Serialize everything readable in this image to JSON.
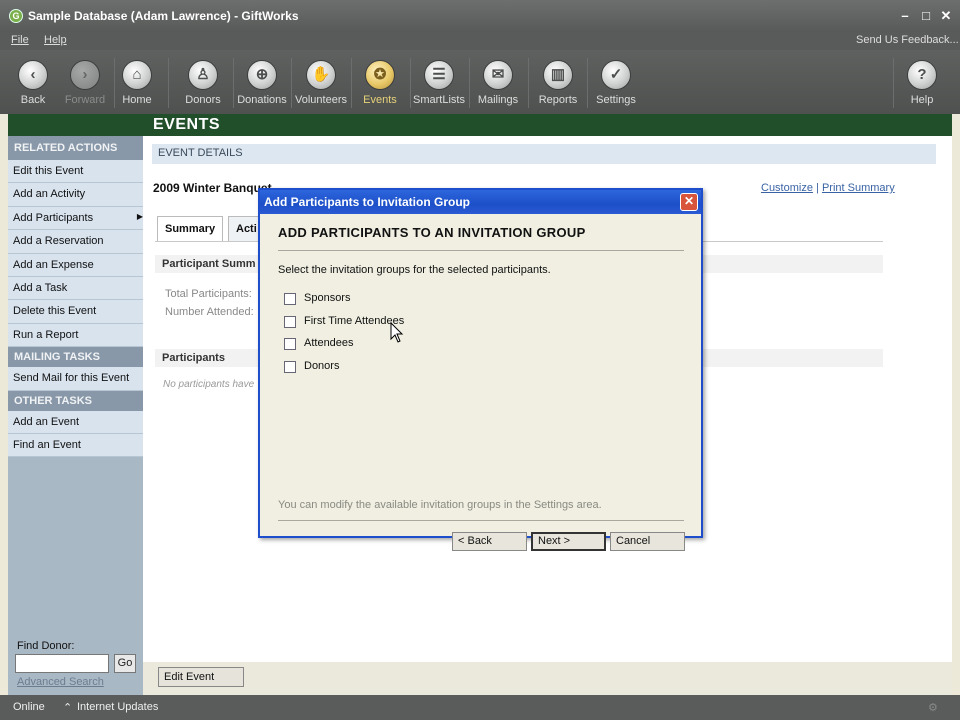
{
  "window": {
    "title": "Sample Database (Adam Lawrence) - GiftWorks",
    "controls": [
      "minimize",
      "maximize",
      "close"
    ]
  },
  "menu": {
    "file": "File",
    "help": "Help",
    "feedback": "Send Us Feedback..."
  },
  "toolbar": {
    "items": [
      {
        "label": "Back",
        "icon": "back-arrow-icon",
        "glyph": "‹"
      },
      {
        "label": "Forward",
        "icon": "forward-arrow-icon",
        "glyph": "›"
      },
      {
        "label": "Home",
        "icon": "home-icon",
        "glyph": "⌂"
      },
      {
        "label": "Donors",
        "icon": "donors-icon",
        "glyph": "♙"
      },
      {
        "label": "Donations",
        "icon": "donations-icon",
        "glyph": "⊕"
      },
      {
        "label": "Volunteers",
        "icon": "volunteers-hand-icon",
        "glyph": "✋"
      },
      {
        "label": "Events",
        "icon": "events-icon",
        "glyph": "✪"
      },
      {
        "label": "SmartLists",
        "icon": "smartlists-icon",
        "glyph": "☰"
      },
      {
        "label": "Mailings",
        "icon": "mailings-envelope-icon",
        "glyph": "✉"
      },
      {
        "label": "Reports",
        "icon": "reports-chart-icon",
        "glyph": "▥"
      },
      {
        "label": "Settings",
        "icon": "settings-check-icon",
        "glyph": "✓"
      },
      {
        "label": "Help",
        "icon": "help-question-icon",
        "glyph": "?"
      }
    ]
  },
  "section_header": "EVENTS",
  "sidebar": {
    "related_actions_header": "RELATED ACTIONS",
    "related_actions": [
      "Edit this Event",
      "Add an Activity",
      "Add Participants",
      "Add a Reservation",
      "Add an Expense",
      "Add a Task",
      "Delete this Event",
      "Run a Report"
    ],
    "mailing_tasks_header": "MAILING TASKS",
    "mailing_tasks": [
      "Send Mail for this Event"
    ],
    "other_tasks_header": "OTHER TASKS",
    "other_tasks": [
      "Add an Event",
      "Find an Event"
    ],
    "find_donor_label": "Find Donor:",
    "find_donor_value": "",
    "go_label": "Go",
    "advanced_search": "Advanced Search"
  },
  "main": {
    "details_bar": "EVENT DETAILS",
    "event_title": "2009 Winter Banquet",
    "customize": "Customize",
    "link_sep": " | ",
    "print_summary": "Print Summary",
    "tabs": [
      "Summary",
      "Acti"
    ],
    "participant_summary": "Participant Summ",
    "total_participants": "Total Participants:",
    "number_attended": "Number Attended:",
    "participants_header": "Participants",
    "no_participants": "No participants have",
    "edit_event": "Edit Event"
  },
  "dialog": {
    "title": "Add Participants to Invitation Group",
    "heading": "ADD PARTICIPANTS TO AN INVITATION GROUP",
    "instruction": "Select the invitation groups for the selected participants.",
    "groups": [
      {
        "label": "Sponsors",
        "checked": false
      },
      {
        "label": "First Time Attendees",
        "checked": false
      },
      {
        "label": "Attendees",
        "checked": false
      },
      {
        "label": "Donors",
        "checked": false
      }
    ],
    "note": "You can modify the available invitation groups in the Settings area.",
    "back": "< Back",
    "next": "Next >",
    "cancel": "Cancel"
  },
  "status": {
    "online": "Online",
    "updates": "Internet Updates"
  }
}
